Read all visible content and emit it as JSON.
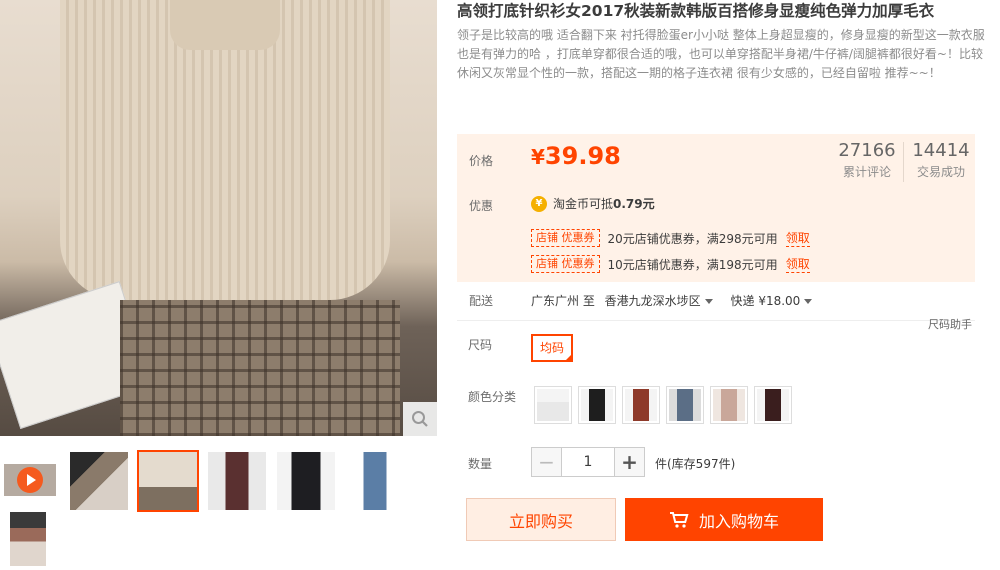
{
  "product": {
    "title": "高领打底针织衫女2017秋装新款韩版百搭修身显瘦纯色弹力加厚毛衣",
    "description": "领子是比较高的哦 适合翻下来 衬托得脸蛋er小小哒 整体上身超显瘦的，修身显瘦的新型这一款衣服也是有弹力的哈 ，打底单穿都很合适的哦，也可以单穿搭配半身裙/牛仔裤/阔腿裤都很好看~！比较休闲又灰常显个性的一款，搭配这一期的格子连衣裙 很有少女感的，已经自留啦 推荐~~！"
  },
  "price": {
    "label": "价格",
    "symbol": "¥",
    "value": "39.98",
    "reviews_count": "27166",
    "reviews_label": "累计评论",
    "sales_count": "14414",
    "sales_label": "交易成功"
  },
  "promo": {
    "label": "优惠",
    "coin_text": "淘金币可抵",
    "coin_amount": "0.79元",
    "coupons": [
      {
        "tag": "店铺 优惠券",
        "text": "20元店铺优惠券，满298元可用",
        "action": "领取"
      },
      {
        "tag": "店铺 优惠券",
        "text": "10元店铺优惠券，满198元可用",
        "action": "领取"
      }
    ]
  },
  "shipping": {
    "label": "配送",
    "from": "广东广州 至",
    "to": "香港九龙深水埗区",
    "method": "快递 ¥18.00",
    "size_help": "尺码助手"
  },
  "size": {
    "label": "尺码",
    "selected": "均码"
  },
  "color": {
    "label": "颜色分类",
    "swatches": [
      "#f2f2f2",
      "#1e1e1e",
      "#8e3a2a",
      "#5b6e86",
      "#c9a79a",
      "#3a1e1e"
    ]
  },
  "quantity": {
    "label": "数量",
    "minus": "−",
    "value": "1",
    "plus": "+",
    "stock": "件(库存597件)"
  },
  "actions": {
    "buy_now": "立即购买",
    "add_to_cart": "加入购物车"
  },
  "colors": {
    "accent": "#ff4400",
    "price_bg": "#fff2e8"
  }
}
